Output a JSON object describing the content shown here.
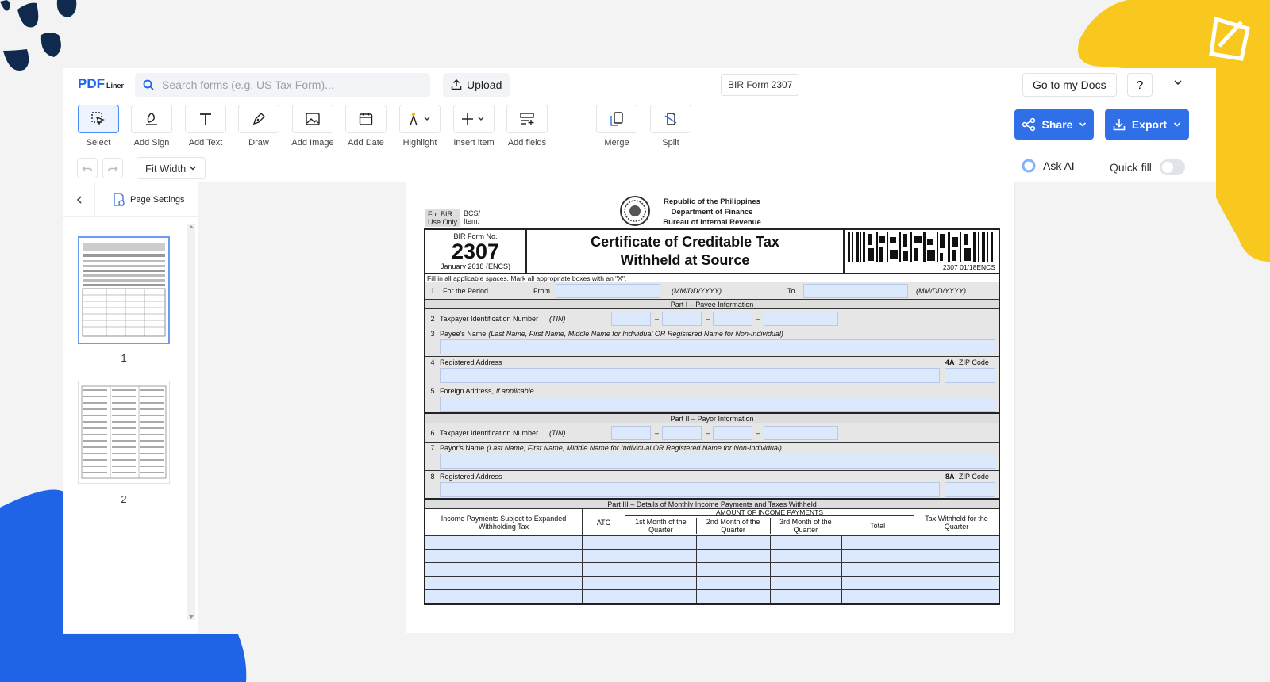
{
  "header": {
    "logo_main": "PDF",
    "logo_sub": "Liner",
    "search_placeholder": "Search forms (e.g. US Tax Form)...",
    "upload_label": "Upload",
    "doc_title": "BIR Form 2307",
    "goto_label": "Go to my Docs",
    "help_label": "?"
  },
  "toolbar": {
    "tools": [
      {
        "label": "Select",
        "icon": "select-cursor-icon"
      },
      {
        "label": "Add Sign",
        "icon": "pen-sign-icon"
      },
      {
        "label": "Add Text",
        "icon": "text-icon"
      },
      {
        "label": "Draw",
        "icon": "draw-pen-icon"
      },
      {
        "label": "Add Image",
        "icon": "image-icon"
      },
      {
        "label": "Add Date",
        "icon": "calendar-icon"
      },
      {
        "label": "Highlight",
        "icon": "highlight-icon"
      },
      {
        "label": "Insert item",
        "icon": "plus-icon"
      },
      {
        "label": "Add fields",
        "icon": "fields-icon"
      },
      {
        "label": "Merge",
        "icon": "merge-icon"
      },
      {
        "label": "Split",
        "icon": "split-icon"
      }
    ],
    "share_label": "Share",
    "export_label": "Export"
  },
  "subbar": {
    "zoom_label": "Fit Width",
    "ask_ai_label": "Ask AI",
    "quick_fill_label": "Quick fill"
  },
  "sidebar": {
    "page_settings_label": "Page Settings",
    "pages": [
      "1",
      "2"
    ]
  },
  "form": {
    "for_bir": "For BIR",
    "use_only": "Use Only",
    "bcs": "BCS/",
    "item": "Item:",
    "republic": "Republic of the Philippines",
    "dept": "Department of Finance",
    "bureau": "Bureau of Internal Revenue",
    "form_no_label": "BIR Form No.",
    "form_no": "2307",
    "form_date": "January 2018 (ENCS)",
    "title_line1": "Certificate of Creditable Tax",
    "title_line2": "Withheld at Source",
    "barcode_code": "2307 01/18ENCS",
    "instructions": "Fill in all applicable spaces. Mark all appropriate boxes with an \"X\".",
    "row1_num": "1",
    "row1_label": "For the Period",
    "from_label": "From",
    "date_fmt": "(MM/DD/YYYY)",
    "to_label": "To",
    "part1": "Part I – Payee Information",
    "row2_num": "2",
    "row2_label": "Taxpayer Identification Number",
    "tin": "(TIN)",
    "row3_num": "3",
    "row3_label": "Payee's Name",
    "row3_hint": "(Last Name, First Name, Middle Name for Individual OR Registered Name for Non-Individual)",
    "row4_num": "4",
    "row4_label": "Registered Address",
    "zip4_num": "4A",
    "zip_label": "ZIP Code",
    "row5_num": "5",
    "row5_label": "Foreign Address,",
    "row5_hint": "if applicable",
    "part2": "Part II – Payor Information",
    "row6_num": "6",
    "row6_label": "Taxpayer Identification Number",
    "row7_num": "7",
    "row7_label": "Payor's Name",
    "row7_hint": "(Last Name, First Name, Middle Name for Individual OR Registered Name for Non-Individual)",
    "row8_num": "8",
    "row8_label": "Registered Address",
    "zip8_num": "8A",
    "part3": "Part III – Details of Monthly Income Payments and Taxes Withheld",
    "amount_head": "AMOUNT OF INCOME PAYMENTS",
    "col_income": "Income Payments Subject to Expanded Withholding Tax",
    "col_atc": "ATC",
    "col_m1": "1st Month of the Quarter",
    "col_m2": "2nd Month of the Quarter",
    "col_m3": "3rd Month of the Quarter",
    "col_total": "Total",
    "col_tax": "Tax Withheld for the Quarter",
    "dash": "–"
  },
  "colors": {
    "accent": "#2f6fe8",
    "yellow": "#f9c81e",
    "blue_blob": "#1f63e6",
    "navy": "#0f2a4d",
    "field": "#dce8fb"
  }
}
